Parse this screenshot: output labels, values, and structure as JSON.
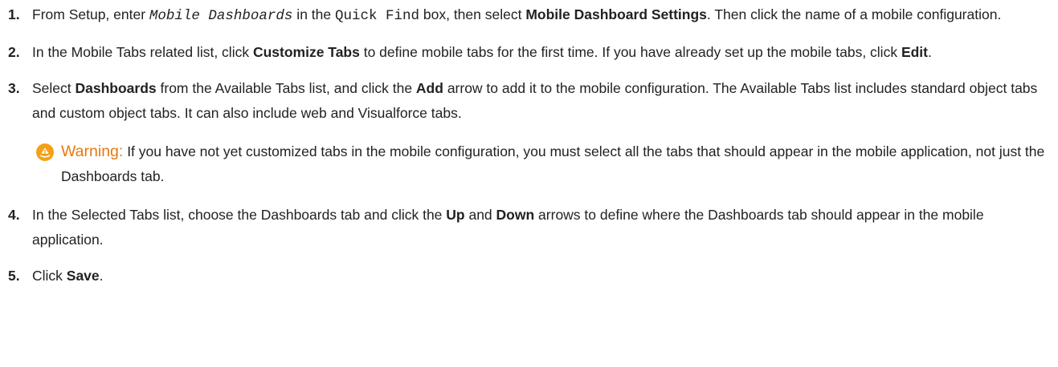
{
  "steps": [
    {
      "number": "1.",
      "parts": {
        "a": "From Setup, enter ",
        "code1": "Mobile Dashboards",
        "b": " in the ",
        "code2": "Quick Find",
        "c": " box, then select ",
        "bold1": "Mobile Dashboard Settings",
        "d": ". Then click the name of a mobile configuration."
      }
    },
    {
      "number": "2.",
      "parts": {
        "a": "In the Mobile Tabs related list, click ",
        "bold1": "Customize Tabs",
        "b": " to define mobile tabs for the first time. If you have already set up the mobile tabs, click ",
        "bold2": "Edit",
        "c": "."
      }
    },
    {
      "number": "3.",
      "parts": {
        "a": "Select ",
        "bold1": "Dashboards",
        "b": " from the Available Tabs list, and click the ",
        "bold2": "Add",
        "c": " arrow to add it to the mobile configuration. The Available Tabs list includes standard object tabs and custom object tabs. It can also include web and Visualforce tabs."
      }
    },
    {
      "number": "4.",
      "parts": {
        "a": "In the Selected Tabs list, choose the Dashboards tab and click the ",
        "bold1": "Up",
        "b": " and ",
        "bold2": "Down",
        "c": " arrows to define where the Dashboards tab should appear in the mobile application."
      }
    },
    {
      "number": "5.",
      "parts": {
        "a": "Click ",
        "bold1": "Save",
        "b": "."
      }
    }
  ],
  "warning": {
    "icon": "warning-icon",
    "icon_color": "#f4a118",
    "label": "Warning:",
    "label_color": "#e8780c",
    "text": "If you have not yet customized tabs in the mobile configuration, you must select all the tabs that should appear in the mobile application, not just the Dashboards tab."
  }
}
